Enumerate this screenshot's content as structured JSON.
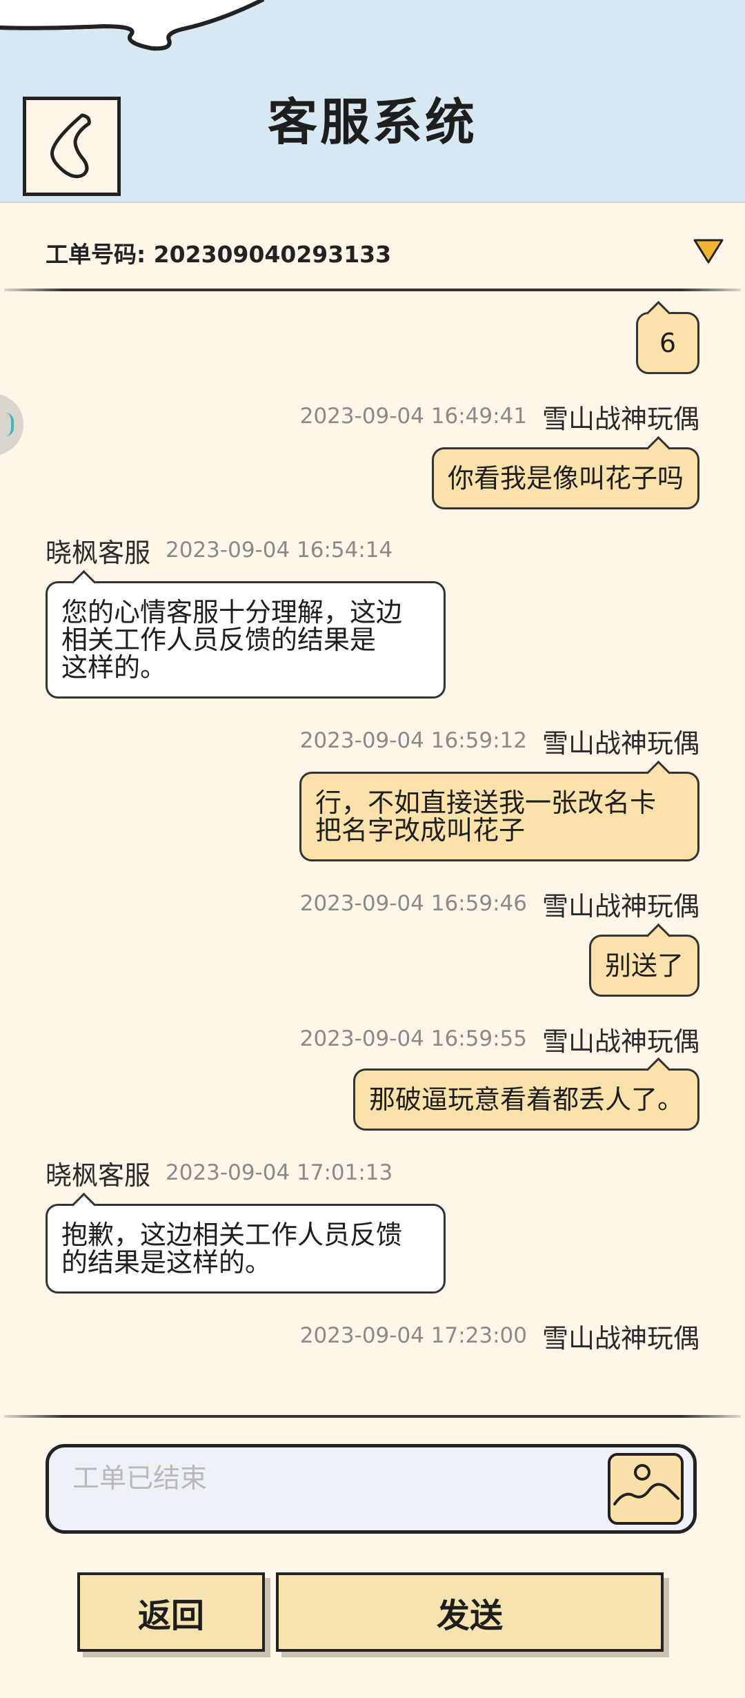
{
  "header": {
    "title": "客服系统"
  },
  "ticket": {
    "label": "工单号码: 202309040293133"
  },
  "messages": [
    {
      "side": "right",
      "text": "6"
    },
    {
      "side": "right",
      "time": "2023-09-04 16:49:41",
      "name": "雪山战神玩偶",
      "text": "你看我是像叫花子吗"
    },
    {
      "side": "left",
      "time": "2023-09-04 16:54:14",
      "name": "晓枫客服",
      "text": "您的心情客服十分理解，这边\n相关工作人员反馈的结果是\n这样的。"
    },
    {
      "side": "right",
      "time": "2023-09-04 16:59:12",
      "name": "雪山战神玩偶",
      "text": "行，不如直接送我一张改名卡\n把名字改成叫花子"
    },
    {
      "side": "right",
      "time": "2023-09-04 16:59:46",
      "name": "雪山战神玩偶",
      "text": "别送了"
    },
    {
      "side": "right",
      "time": "2023-09-04 16:59:55",
      "name": "雪山战神玩偶",
      "text": "那破逼玩意看着都丢人了。"
    },
    {
      "side": "left",
      "time": "2023-09-04 17:01:13",
      "name": "晓枫客服",
      "text": "抱歉，这边相关工作人员反馈\n的结果是这样的。"
    },
    {
      "side": "right",
      "time": "2023-09-04 17:23:00",
      "name": "雪山战神玩偶"
    }
  ],
  "input": {
    "placeholder": "工单已结束"
  },
  "buttons": {
    "back": "返回",
    "send": "发送"
  },
  "icons": {
    "back": "back-arrow-icon",
    "dropdown": "triangle-down-icon",
    "image": "image-picture-icon"
  },
  "colors": {
    "header_bg": "#d7e8f3",
    "page_bg": "#fdf6e9",
    "user_bubble": "#fbe1aa",
    "agent_bubble": "#ffffff",
    "button_bg": "#f7e3b0",
    "dropdown": "#f2b531"
  }
}
